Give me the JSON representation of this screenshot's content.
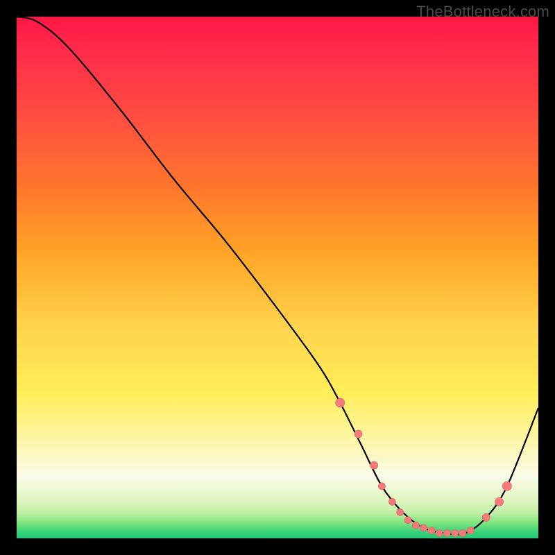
{
  "watermark": "TheBottleneck.com",
  "colors": {
    "curve": "#000000",
    "marker_fill": "#f27a7a",
    "marker_stroke": "#e86a6a"
  },
  "chart_data": {
    "type": "line",
    "title": "",
    "xlabel": "",
    "ylabel": "",
    "xlim": [
      0,
      100
    ],
    "ylim": [
      0,
      100
    ],
    "grid": false,
    "legend": false,
    "series": [
      {
        "name": "curve",
        "x": [
          0,
          4,
          10,
          20,
          30,
          40,
          50,
          58,
          62,
          66,
          70,
          74,
          78,
          82,
          86,
          90,
          94,
          100
        ],
        "y": [
          100,
          99,
          94,
          82,
          69,
          57,
          44,
          33,
          26,
          18,
          10,
          5,
          2,
          1,
          1,
          4,
          10,
          25
        ]
      }
    ],
    "markers": {
      "name": "highlight",
      "x": [
        62,
        65.5,
        68.5,
        70,
        72,
        73.5,
        75,
        76.5,
        78,
        79.5,
        81,
        82.5,
        84,
        85.5,
        87,
        90,
        92.5,
        94
      ],
      "y": [
        26,
        20,
        14,
        10,
        7,
        5,
        3.5,
        2.5,
        2,
        1.5,
        1,
        1,
        1,
        1,
        1.5,
        4,
        7,
        10
      ],
      "sizes": [
        6.5,
        5.5,
        5.5,
        5,
        5,
        5,
        5,
        5,
        5,
        5,
        5,
        5,
        5,
        5,
        5,
        5.5,
        6,
        6.5
      ]
    }
  }
}
